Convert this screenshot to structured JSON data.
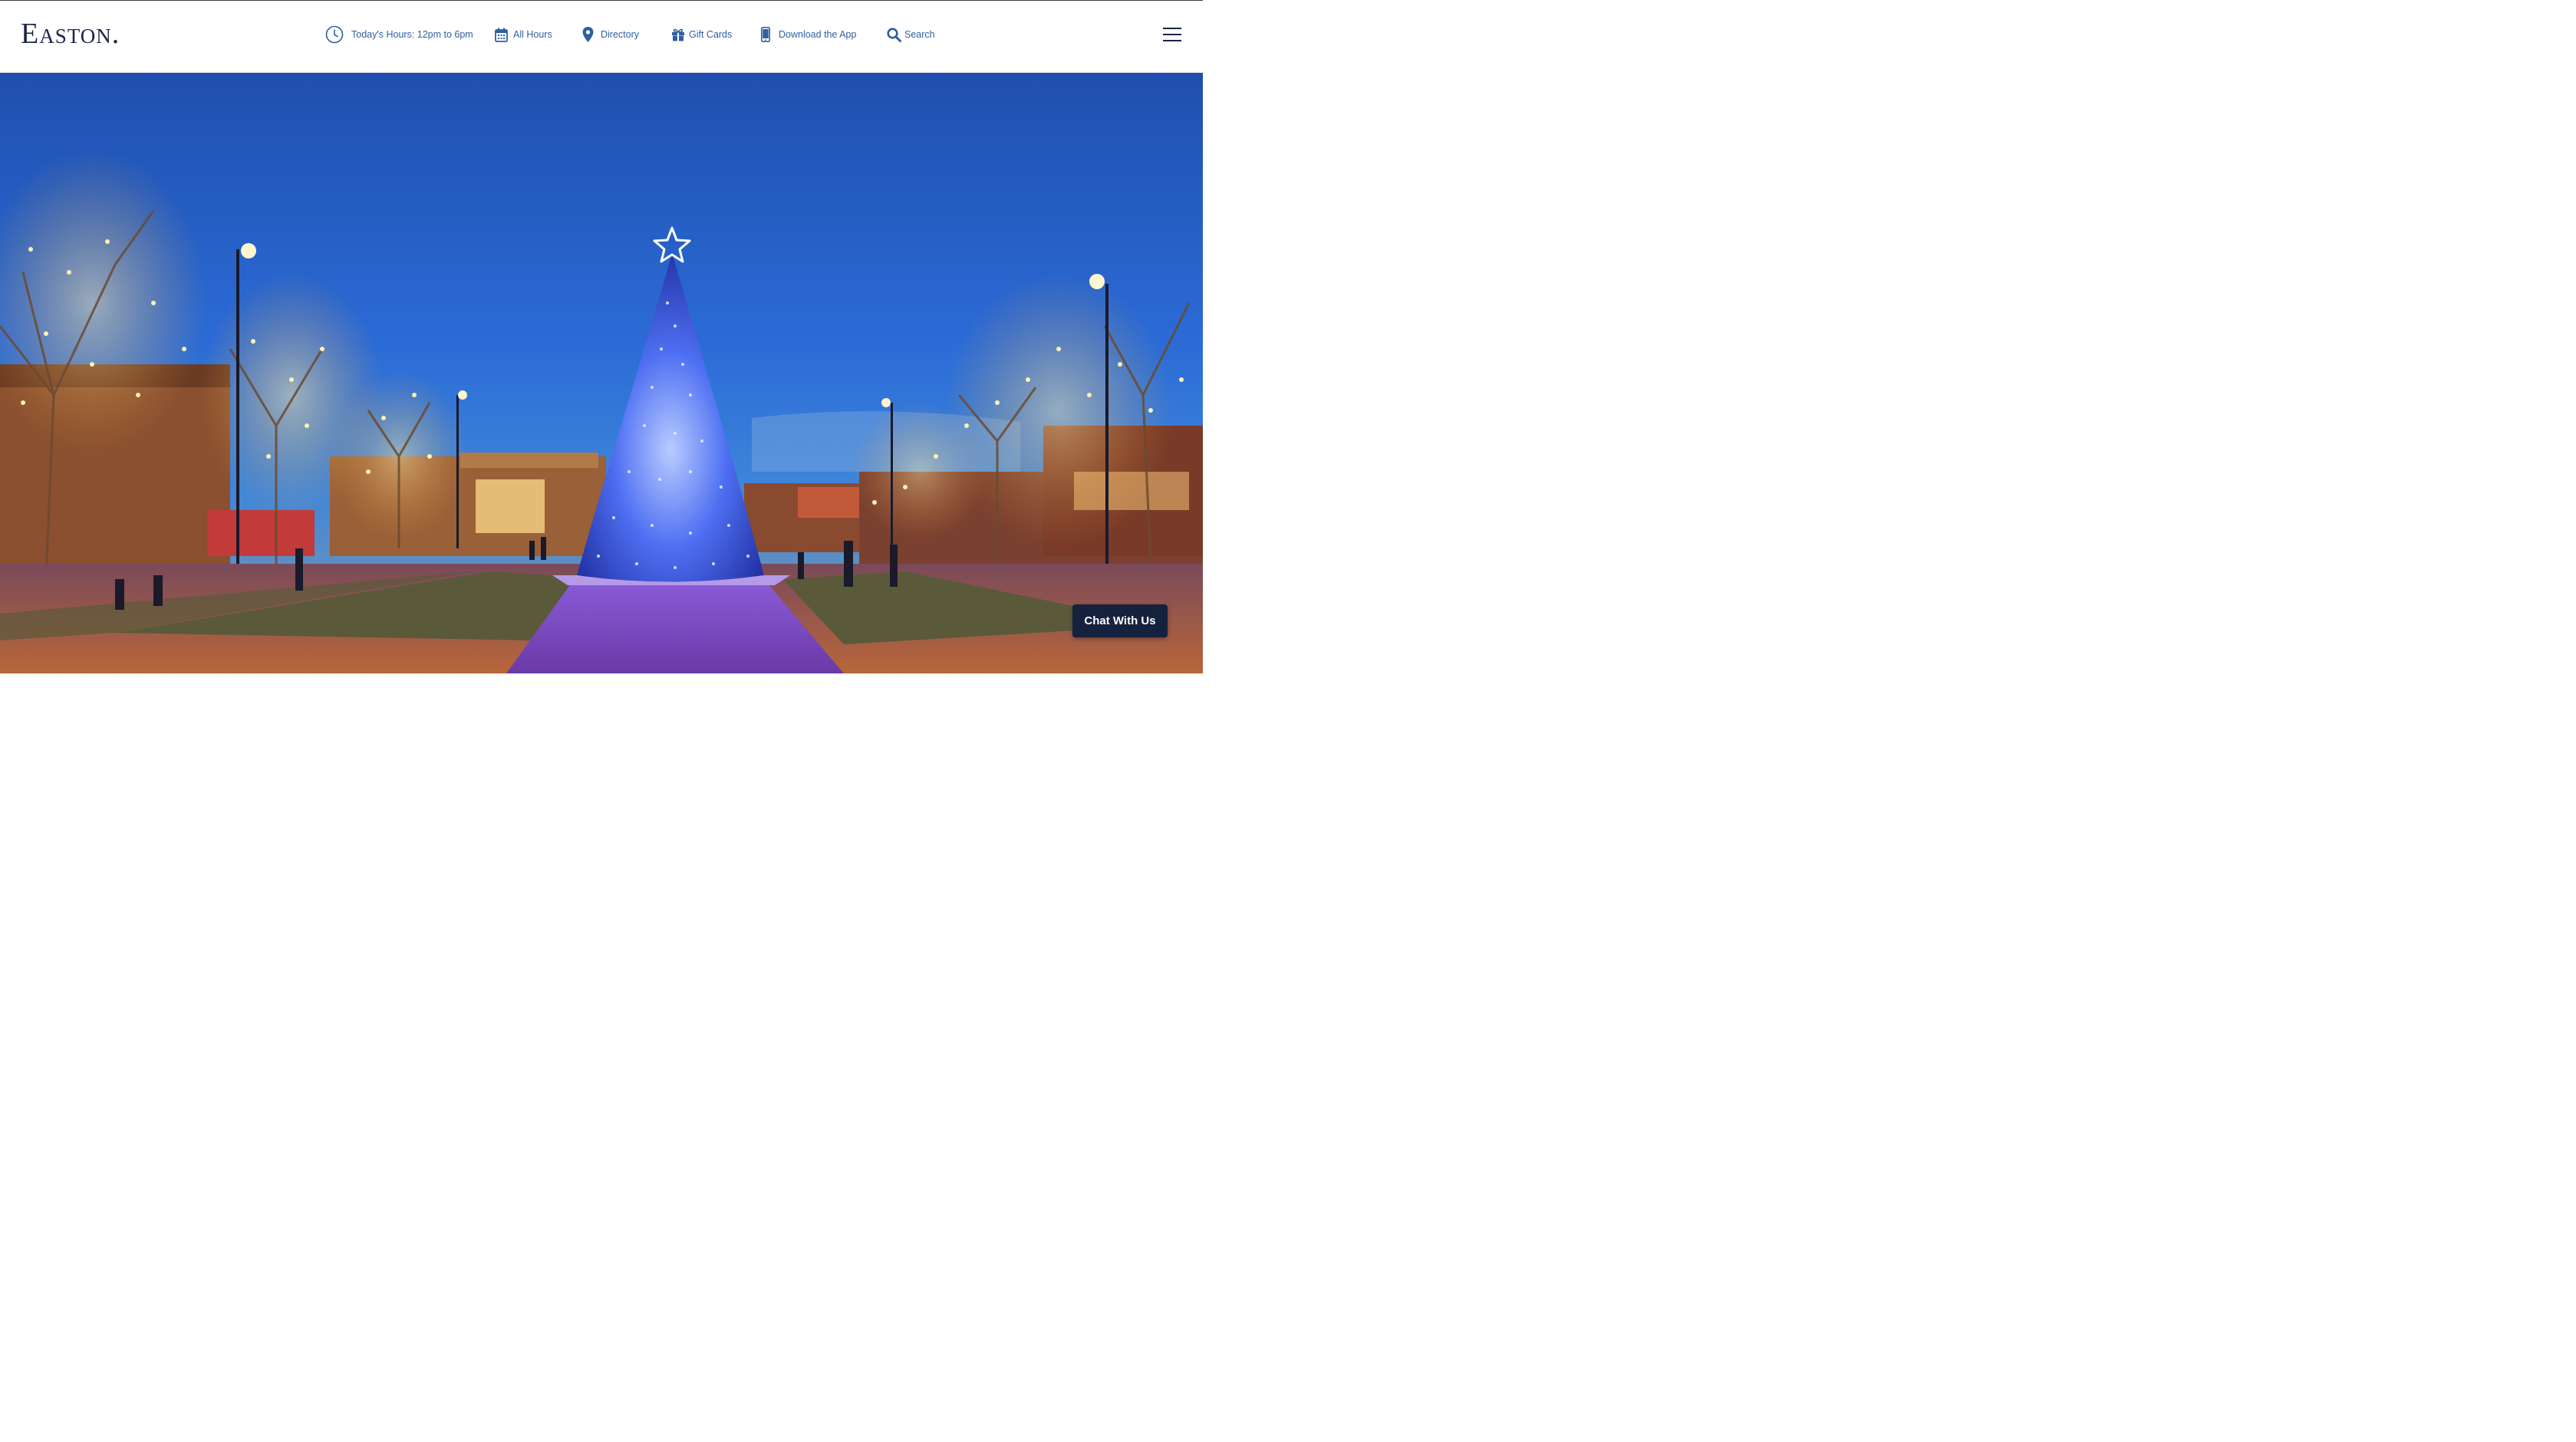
{
  "brand": {
    "logo_text": "Easton."
  },
  "colors": {
    "nav_blue": "#2f5f9e",
    "brand_navy": "#1a2547",
    "chat_bg": "#15213d"
  },
  "nav": {
    "items": [
      {
        "label": "Today's Hours: 12pm to 6pm",
        "icon": "clock-icon"
      },
      {
        "label": "All Hours",
        "icon": "calendar-icon"
      },
      {
        "label": "Directory",
        "icon": "map-pin-icon"
      },
      {
        "label": "Gift Cards",
        "icon": "gift-icon"
      },
      {
        "label": "Download the App",
        "icon": "smartphone-icon"
      },
      {
        "label": "Search",
        "icon": "search-icon"
      }
    ],
    "menu_icon": "hamburger-menu-icon"
  },
  "hero": {
    "image_subject": "illuminated blue christmas tree at night in town square"
  },
  "chat": {
    "label": "Chat With Us"
  }
}
